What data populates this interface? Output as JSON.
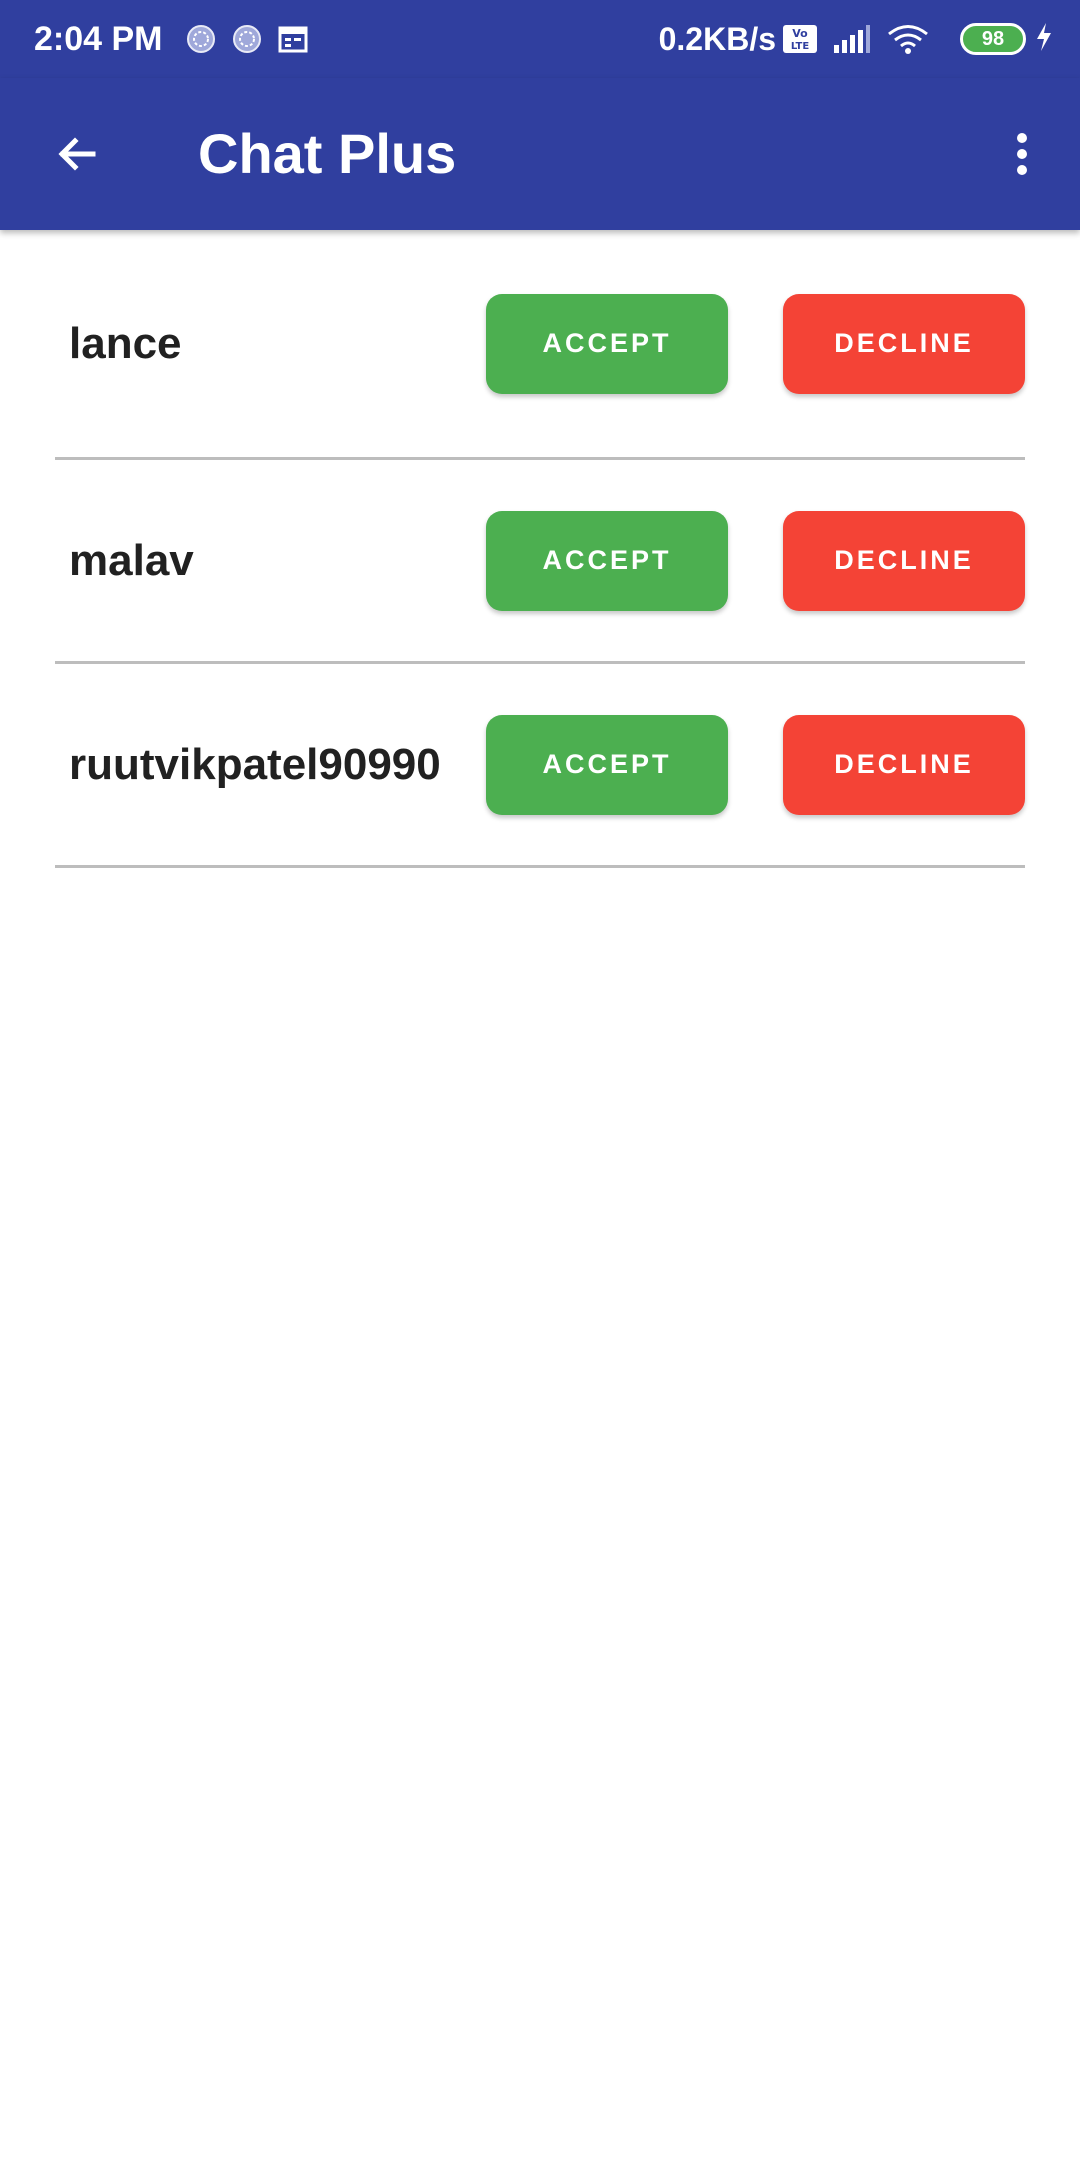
{
  "status_bar": {
    "time": "2:04 PM",
    "left_icons": [
      "sync-circle-icon",
      "sync-circle-icon",
      "calendar-icon"
    ],
    "network_speed": "0.2KB/s",
    "volte": "Vo LTE",
    "battery_level": "98",
    "right_icons": [
      "volte-icon",
      "signal-icon",
      "wifi-icon",
      "battery-icon",
      "charging-icon"
    ]
  },
  "app_bar": {
    "title": "Chat Plus",
    "back_icon": "arrow-left-icon",
    "menu_icon": "more-vertical-icon",
    "background": "#303f9f"
  },
  "requests": [
    {
      "name": "lance",
      "accept_label": "ACCEPT",
      "decline_label": "DECLINE"
    },
    {
      "name": "malav",
      "accept_label": "ACCEPT",
      "decline_label": "DECLINE"
    },
    {
      "name": "ruutvikpatel90990",
      "accept_label": "ACCEPT",
      "decline_label": "DECLINE"
    }
  ],
  "colors": {
    "accept": "#4caf50",
    "decline": "#f44336",
    "divider": "#bdbdbd"
  }
}
